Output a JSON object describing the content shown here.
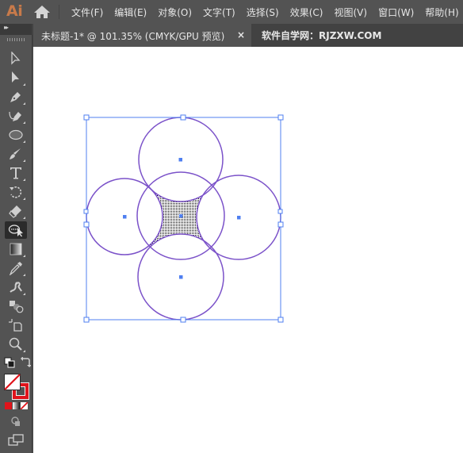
{
  "app": {
    "logo": "Ai",
    "home_icon": "home-icon"
  },
  "menu": {
    "items": [
      {
        "label": "文件(F)"
      },
      {
        "label": "编辑(E)"
      },
      {
        "label": "对象(O)"
      },
      {
        "label": "文字(T)"
      },
      {
        "label": "选择(S)"
      },
      {
        "label": "效果(C)"
      },
      {
        "label": "视图(V)"
      },
      {
        "label": "窗口(W)"
      },
      {
        "label": "帮助(H)"
      }
    ]
  },
  "document_tab": {
    "title": "未标题-1* @ 101.35% (CMYK/GPU 预览)",
    "close_label": "×"
  },
  "watermark": "软件自学网：RJZXW.COM",
  "toolbar": {
    "collapse_label": "▸▸",
    "tools": [
      {
        "name": "selection-tool",
        "icon": "arrow-outline-icon"
      },
      {
        "name": "direct-selection-tool",
        "icon": "arrow-filled-icon"
      },
      {
        "name": "pen-tool",
        "icon": "pen-icon"
      },
      {
        "name": "curvature-tool",
        "icon": "curvature-pen-icon"
      },
      {
        "name": "ellipse-tool",
        "icon": "ellipse-icon"
      },
      {
        "name": "paintbrush-tool",
        "icon": "brush-icon"
      },
      {
        "name": "type-tool",
        "icon": "type-icon",
        "label": "T"
      },
      {
        "name": "rotate-tool",
        "icon": "rotate-icon"
      },
      {
        "name": "eraser-tool",
        "icon": "eraser-icon"
      },
      {
        "name": "shape-builder-tool",
        "icon": "shape-builder-icon",
        "active": true
      },
      {
        "name": "gradient-tool",
        "icon": "gradient-icon"
      },
      {
        "name": "eyedropper-tool",
        "icon": "eyedropper-icon"
      },
      {
        "name": "puppet-warp-tool",
        "icon": "puppet-warp-icon"
      },
      {
        "name": "blend-tool",
        "icon": "blend-icon"
      },
      {
        "name": "artboard-tool",
        "icon": "artboard-icon"
      },
      {
        "name": "zoom-tool",
        "icon": "magnifier-icon"
      }
    ],
    "fill_stroke": {
      "fill": "none",
      "stroke": "#e0141b"
    },
    "color_modes": [
      "color",
      "gradient",
      "none"
    ]
  },
  "artwork": {
    "stroke_color": "#7b52c9",
    "selection_color": "#4f7ff0",
    "fill_pattern": "dotted-black",
    "circles": [
      {
        "name": "top"
      },
      {
        "name": "left"
      },
      {
        "name": "center"
      },
      {
        "name": "right"
      },
      {
        "name": "bottom"
      }
    ]
  }
}
